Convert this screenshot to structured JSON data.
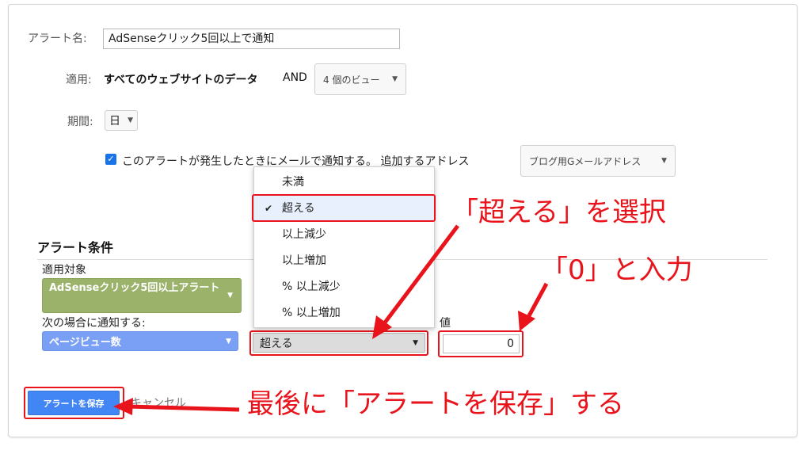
{
  "form": {
    "alert_name_label": "アラート名:",
    "alert_name_value": "AdSenseクリック5回以上で通知",
    "apply_label": "適用:",
    "apply_scope": "すべてのウェブサイトのデータ",
    "apply_and": "AND",
    "views_button": "4 個のビュー",
    "period_label": "期間:",
    "period_value": "日",
    "email_checkbox_text": "このアラートが発生したときにメールで通知する。 追加するアドレス",
    "email_address_button": "ブログ用Gメールアドレス"
  },
  "conditions": {
    "title": "アラート条件",
    "target_label": "適用対象",
    "target_value": "AdSenseクリック5回以上アラート",
    "notify_label": "次の場合に通知する:",
    "metric_value": "ページビュー数",
    "condition_value": "超える",
    "value_label": "値",
    "value": "0"
  },
  "dropdown": {
    "items": [
      "未満",
      "超える",
      "以上減少",
      "以上増加",
      "% 以上減少",
      "% 以上増加"
    ],
    "selected": "超える",
    "check": "✔"
  },
  "actions": {
    "save": "アラートを保存",
    "cancel": "キャンセル"
  },
  "annotations": {
    "select_note": "「超える」を選択",
    "input_note": "「0」と入力",
    "save_note": "最後に「アラートを保存」する"
  },
  "colors": {
    "annotation_red": "#e8131b",
    "save_blue": "#4285f4",
    "segment_green": "#9bb26b",
    "metric_blue": "#7aa0f5"
  }
}
